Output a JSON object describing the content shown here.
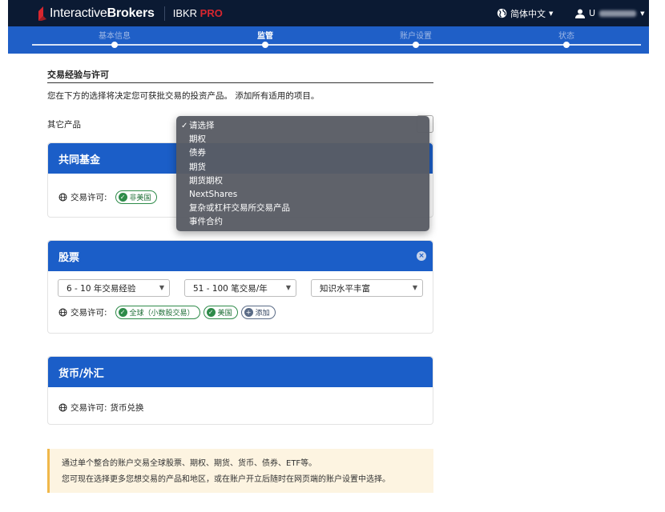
{
  "header": {
    "logo_text_plain": "Interactive",
    "logo_text_bold": "Brokers",
    "product": "IBKR",
    "product_accent": "PRO",
    "language": "简体中文",
    "user": "U"
  },
  "steps": [
    {
      "label": "基本信息",
      "active": false
    },
    {
      "label": "监管",
      "active": true
    },
    {
      "label": "账户设置",
      "active": false
    },
    {
      "label": "状态",
      "active": false
    }
  ],
  "section": {
    "title": "交易经验与许可",
    "description": "您在下方的选择将决定您可获批交易的投资产品。 添加所有适用的项目。",
    "other_products_label": "其它产品"
  },
  "dropdown": {
    "items": [
      "请选择",
      "期权",
      "债券",
      "期货",
      "期货期权",
      "NextShares",
      "复杂或杠杆交易所交易产品",
      "事件合约"
    ],
    "selected_index": 0
  },
  "mutual_funds": {
    "title": "共同基金",
    "permission_label": "交易许可:",
    "pills": [
      "非美国"
    ]
  },
  "stocks": {
    "title": "股票",
    "experience": "6 - 10 年交易经验",
    "trades": "51 - 100 笔交易/年",
    "knowledge": "知识水平丰富",
    "permission_label": "交易许可:",
    "pills": [
      "全球（小数股交易）",
      "美国"
    ],
    "add_label": "添加"
  },
  "forex": {
    "title": "货币/外汇",
    "permission_label": "交易许可:",
    "permission_value": "货币兑换"
  },
  "info": {
    "line1": "通过单个整合的账户交易全球股票、期权、期货、货币、债券、ETF等。",
    "line2": "您可现在选择更多您想交易的产品和地区，或在账户开立后随时在网页端的账户设置中选择。"
  },
  "colors": {
    "topbar": "#0b1a33",
    "progress": "#1f5fc7",
    "card_header": "#1b5ec8",
    "pill_green": "#2e8b49",
    "info_bg": "#fdf4e1",
    "info_border": "#f0b84a",
    "brand_red": "#d8262f"
  }
}
